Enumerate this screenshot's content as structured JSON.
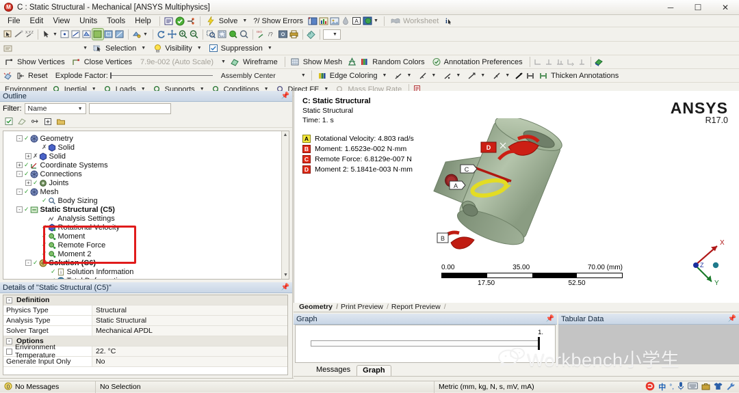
{
  "window": {
    "title": "C : Static Structural - Mechanical [ANSYS Multiphysics]",
    "app_icon": "mechanical-app-icon",
    "minimize": "─",
    "maximize": "☐",
    "close": "✕"
  },
  "menubar": {
    "items": [
      "File",
      "Edit",
      "View",
      "Units",
      "Tools",
      "Help"
    ],
    "solve_label": "Solve",
    "show_errors_label": "?/ Show Errors",
    "worksheet_label": "Worksheet"
  },
  "toolbar_selection": {
    "selection": "Selection",
    "visibility": "Visibility",
    "suppression": "Suppression"
  },
  "toolbar_display": {
    "show_vertices": "Show Vertices",
    "close_vertices": "Close Vertices",
    "auto_scale": "7.9e-002 (Auto Scale)",
    "wireframe": "Wireframe",
    "show_mesh": "Show Mesh",
    "random_colors": "Random Colors",
    "annotation_preferences": "Annotation Preferences"
  },
  "toolbar_explode": {
    "reset": "Reset",
    "explode_factor": "Explode Factor:",
    "assembly_center": "Assembly Center",
    "edge_coloring": "Edge Coloring",
    "thicken_annotations": "Thicken Annotations"
  },
  "toolbar_environment": {
    "environment": "Environment",
    "inertial": "Inertial",
    "loads": "Loads",
    "supports": "Supports",
    "conditions": "Conditions",
    "direct_fe": "Direct FE",
    "mass_flow_rate": "Mass Flow Rate"
  },
  "outline": {
    "title": "Outline",
    "filter_label": "Filter:",
    "filter_value": "Name",
    "filter_text": "",
    "tree": [
      {
        "label": "Geometry",
        "indent": 1,
        "expander": "-",
        "check": true,
        "icon": "geometry-icon",
        "bold": false
      },
      {
        "label": "Solid",
        "indent": 3,
        "expander": "",
        "check": false,
        "icon": "solid-icon",
        "bold": false,
        "suppressed": true
      },
      {
        "label": "Solid",
        "indent": 2,
        "expander": "+",
        "check": false,
        "icon": "solid-icon",
        "bold": false,
        "suppressed": true
      },
      {
        "label": "Coordinate Systems",
        "indent": 1,
        "expander": "+",
        "check": true,
        "icon": "coordinate-systems-icon",
        "bold": false
      },
      {
        "label": "Connections",
        "indent": 1,
        "expander": "-",
        "check": true,
        "icon": "connections-icon",
        "bold": false
      },
      {
        "label": "Joints",
        "indent": 2,
        "expander": "+",
        "check": true,
        "icon": "joints-icon",
        "bold": false
      },
      {
        "label": "Mesh",
        "indent": 1,
        "expander": "-",
        "check": true,
        "icon": "mesh-icon",
        "bold": false
      },
      {
        "label": "Body Sizing",
        "indent": 3,
        "expander": "",
        "check": true,
        "icon": "body-sizing-icon",
        "bold": false
      },
      {
        "label": "Static Structural (C5)",
        "indent": 1,
        "expander": "-",
        "check": true,
        "icon": "environment-icon",
        "bold": true
      },
      {
        "label": "Analysis Settings",
        "indent": 3,
        "expander": "",
        "check": false,
        "icon": "analysis-settings-icon",
        "bold": false
      },
      {
        "label": "Rotational Velocity",
        "indent": 3,
        "expander": "",
        "check": true,
        "icon": "rotational-velocity-icon",
        "bold": false
      },
      {
        "label": "Moment",
        "indent": 3,
        "expander": "",
        "check": true,
        "icon": "moment-icon",
        "bold": false
      },
      {
        "label": "Remote Force",
        "indent": 3,
        "expander": "",
        "check": true,
        "icon": "remote-force-icon",
        "bold": false
      },
      {
        "label": "Moment 2",
        "indent": 3,
        "expander": "",
        "check": true,
        "icon": "moment-icon",
        "bold": false
      },
      {
        "label": "Solution (C6)",
        "indent": 2,
        "expander": "-",
        "check": true,
        "icon": "solution-icon",
        "bold": true
      },
      {
        "label": "Solution Information",
        "indent": 4,
        "expander": "",
        "check": true,
        "icon": "solution-information-icon",
        "bold": false
      },
      {
        "label": "Total Deformation",
        "indent": 4,
        "expander": "",
        "check": true,
        "icon": "total-deformation-icon",
        "bold": false
      }
    ],
    "highlight_color": "#e01b1b"
  },
  "details": {
    "title": "Details of \"Static Structural (C5)\"",
    "rows": [
      {
        "type": "section",
        "key": "Definition",
        "value": ""
      },
      {
        "type": "row",
        "key": "Physics Type",
        "value": "Structural"
      },
      {
        "type": "row",
        "key": "Analysis Type",
        "value": "Static Structural"
      },
      {
        "type": "row",
        "key": "Solver Target",
        "value": "Mechanical APDL"
      },
      {
        "type": "section",
        "key": "Options",
        "value": ""
      },
      {
        "type": "check",
        "key": "Environment Temperature",
        "value": "22. °C"
      },
      {
        "type": "row",
        "key": "Generate Input Only",
        "value": "No"
      }
    ]
  },
  "graphics": {
    "legend_title": "C: Static Structural",
    "legend_sub1": "Static Structural",
    "legend_sub2": "Time: 1. s",
    "annotations": [
      {
        "tag": "A",
        "label": "Rotational Velocity: 4.803 rad/s",
        "color": "#f5e93c"
      },
      {
        "tag": "B",
        "label": "Moment: 1.6523e-002 N·mm",
        "color": "#e02b18"
      },
      {
        "tag": "C",
        "label": "Remote Force: 6.8129e-007 N",
        "color": "#e02b18"
      },
      {
        "tag": "D",
        "label": "Moment 2: 5.1841e-003 N·mm",
        "color": "#e02b18"
      }
    ],
    "logo_main": "ANSYS",
    "logo_sub": "R17.0",
    "model_tags": [
      "A",
      "B",
      "C",
      "D"
    ],
    "scale": {
      "major": [
        "0.00",
        "35.00",
        "70.00 (mm)"
      ],
      "minor": [
        "17.50",
        "52.50"
      ]
    },
    "triad": {
      "x": "X",
      "y": "Y",
      "z": "Z"
    },
    "tabs": [
      {
        "label": "Geometry",
        "active": true
      },
      {
        "label": "Print Preview",
        "active": false
      },
      {
        "label": "Report Preview",
        "active": false
      }
    ]
  },
  "graph": {
    "title": "Graph",
    "cursor_label": "1."
  },
  "tabular": {
    "title": "Tabular Data"
  },
  "bottom_tabs": [
    {
      "label": "Messages",
      "active": false
    },
    {
      "label": "Graph",
      "active": true
    }
  ],
  "status": {
    "messages": "No Messages",
    "selection": "No Selection",
    "units": "Metric (mm, kg, N, s, mV, mA)",
    "tray_icons": [
      "sogou-icon",
      "chinese-input-icon",
      "degree-icon",
      "microphone-icon",
      "keyboard-icon",
      "toolbox-icon",
      "shirt-icon",
      "wrench-icon"
    ]
  },
  "watermark": {
    "text": "Workbench小学生"
  }
}
